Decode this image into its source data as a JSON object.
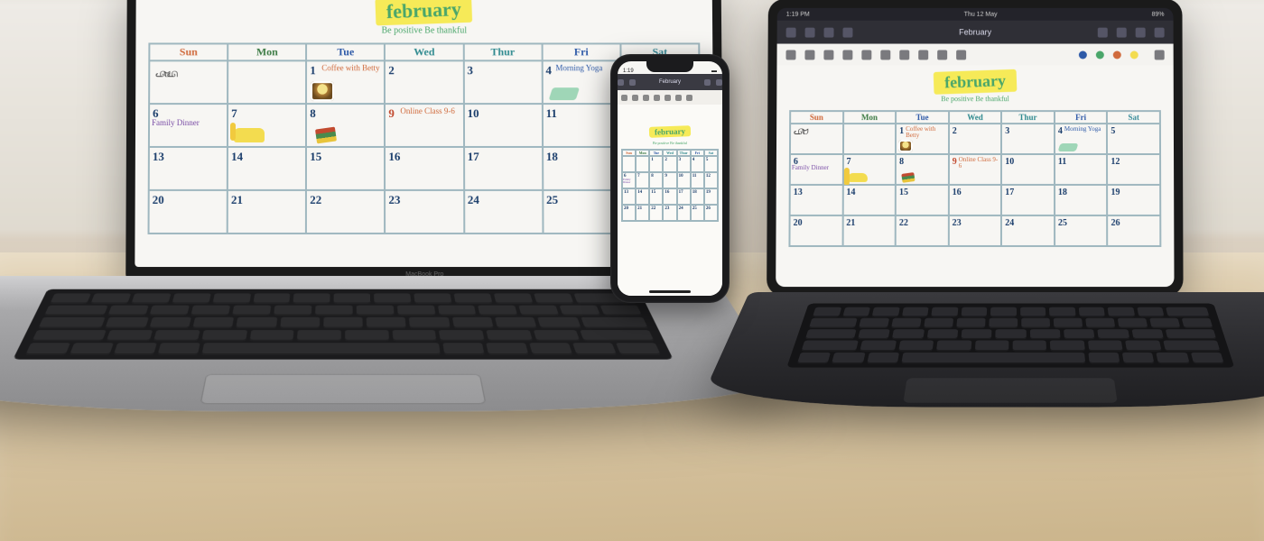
{
  "laptop_brand": "MacBook Pro",
  "ipad_status": {
    "time": "1:19 PM",
    "date": "Thu 12 May",
    "battery": "89%"
  },
  "iphone_status": {
    "time": "1:19"
  },
  "app": {
    "doc_title": "February",
    "toolbar_icons": [
      "back-icon",
      "grid-icon",
      "bookmark-icon",
      "share-icon"
    ],
    "right_icons": [
      "undo-icon",
      "redo-icon",
      "close-icon",
      "more-icon"
    ],
    "tool_row": [
      "pen-icon",
      "pencil-icon",
      "highlighter-icon",
      "eraser-icon",
      "lasso-icon",
      "comment-icon",
      "text-icon",
      "image-icon",
      "link-icon",
      "shapes-icon"
    ],
    "palette": [
      "#111111",
      "#2e5aa8",
      "#4aa66a",
      "#d06a3c",
      "#f3dc4f"
    ]
  },
  "calendar": {
    "month_label": "february",
    "tagline": "Be positive Be thankful",
    "day_headers": [
      "Sun",
      "Mon",
      "Tue",
      "Wed",
      "Thur",
      "Fri",
      "Sat"
    ],
    "weeks": [
      [
        "",
        "",
        "1",
        "2",
        "3",
        "4",
        "5"
      ],
      [
        "6",
        "7",
        "8",
        "9",
        "10",
        "11",
        "12"
      ],
      [
        "13",
        "14",
        "15",
        "16",
        "17",
        "18",
        "19"
      ],
      [
        "20",
        "21",
        "22",
        "23",
        "24",
        "25",
        "26"
      ]
    ],
    "events": {
      "1": {
        "text": "Coffee with Betty",
        "color": "#d06a3c"
      },
      "4": {
        "text": "Morning Yoga",
        "color": "#2e5aa8"
      },
      "6": {
        "text": "Family Dinner",
        "color": "#7a4da6"
      },
      "9": {
        "text": "Online Class 9-6",
        "color": "#d06a3c"
      }
    }
  }
}
